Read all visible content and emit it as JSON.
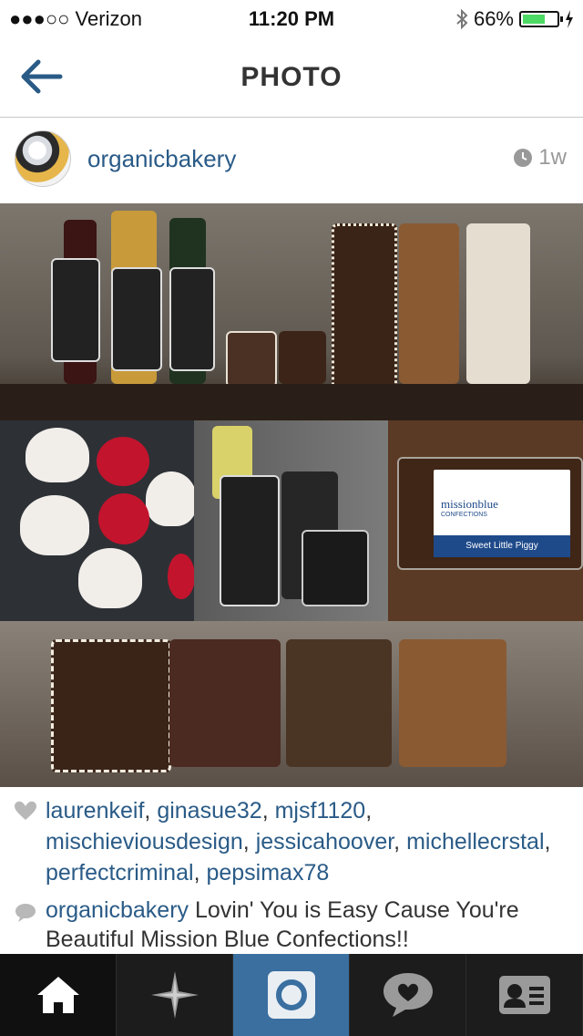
{
  "status_bar": {
    "carrier": "●●●○○ Verizon",
    "time": "11:20 PM",
    "battery": "66%",
    "battery_level": 0.66
  },
  "nav": {
    "title": "PHOTO",
    "back_icon": "back-arrow-icon"
  },
  "post": {
    "username": "organicbakery",
    "time_ago": "1w",
    "likes": [
      "laurenkeif",
      "ginasue32",
      "mjsf1120",
      "mischieviousdesign",
      "jessicahoover",
      "michellecrstal",
      "perfectcriminal",
      "pepsimax78"
    ],
    "comment": {
      "author": "organicbakery",
      "text": "Lovin' You is Easy Cause You're Beautiful Mission Blue Confections!!"
    },
    "photo_label": {
      "brand": "missionblue",
      "brand_sub": "CONFECTIONS",
      "product": "Sweet Little Piggy"
    }
  },
  "tabbar": {
    "tabs": [
      "home-icon",
      "explore-icon",
      "camera-icon",
      "activity-icon",
      "profile-icon"
    ]
  },
  "colors": {
    "link": "#2a5b87",
    "tab_active": "#3a6fa0",
    "tab_bg": "#1c1c1c"
  }
}
